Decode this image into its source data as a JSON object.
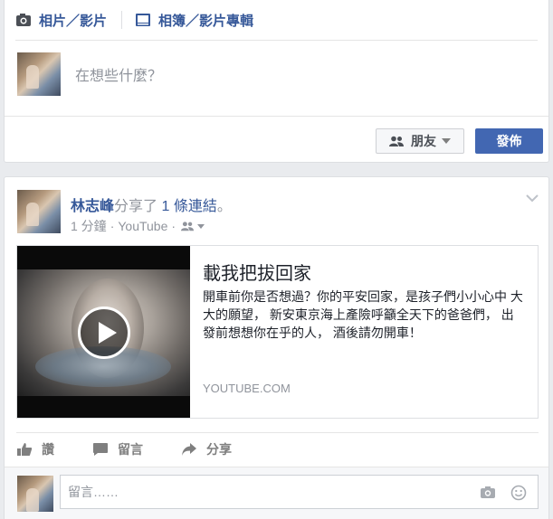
{
  "composer": {
    "tabs": [
      {
        "label": "相片／影片",
        "icon": "camera-icon"
      },
      {
        "label": "相簿／影片專輯",
        "icon": "album-icon"
      }
    ],
    "placeholder": "在想些什麼？",
    "audience_label": "朋友",
    "post_label": "發佈"
  },
  "story": {
    "author": "林志峰",
    "action_text": "分享了",
    "count": "1",
    "link_word": "條連結",
    "trailing": "。",
    "time": "1 分鐘",
    "source": "YouTube",
    "link_card": {
      "title": "載我把拔回家",
      "description": "開車前你是否想過？你的平安回家，是孩子們小小心中 大大的願望， 新安東京海上產險呼籲全天下的爸爸們， 出發前想想你在乎的人， 酒後請勿開車！",
      "domain": "YOUTUBE.COM"
    },
    "actions": [
      {
        "label": "讚",
        "icon": "like-icon"
      },
      {
        "label": "留言",
        "icon": "comment-icon"
      },
      {
        "label": "分享",
        "icon": "share-icon"
      }
    ],
    "comment_placeholder": "留言……"
  },
  "colors": {
    "link_blue": "#365899",
    "primary_button": "#4267b2",
    "muted_text": "#90949c",
    "page_background": "#e9ebee"
  }
}
